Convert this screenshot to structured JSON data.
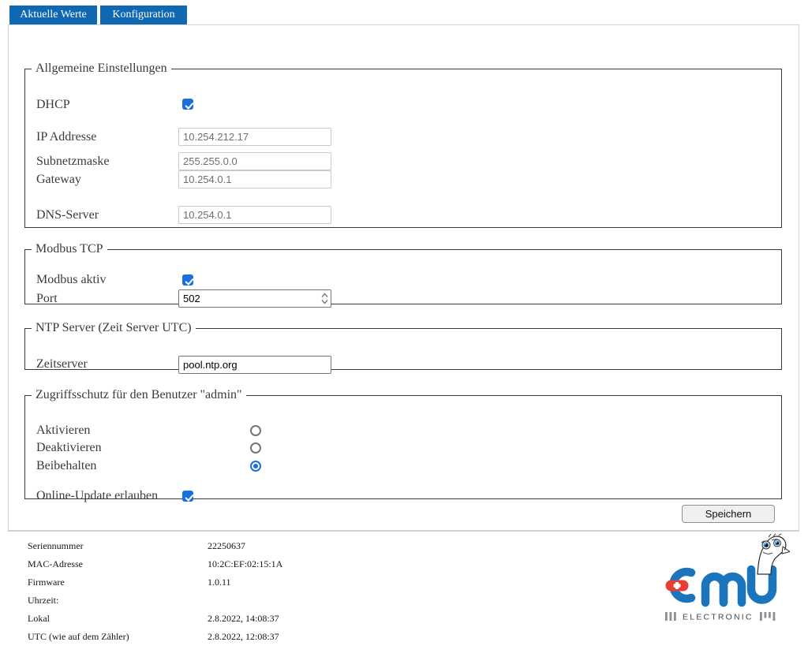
{
  "tabs": [
    {
      "label": "Aktuelle Werte"
    },
    {
      "label": "Konfiguration"
    }
  ],
  "general": {
    "legend": "Allgemeine Einstellungen",
    "dhcp": {
      "label": "DHCP",
      "checked": true
    },
    "fields": {
      "ip": {
        "label": "IP Addresse",
        "value": "10.254.212.17",
        "disabled": true
      },
      "subnet": {
        "label": "Subnetzmaske",
        "value": "255.255.0.0",
        "disabled": true
      },
      "gateway": {
        "label": "Gateway",
        "value": "10.254.0.1",
        "disabled": true
      },
      "dns": {
        "label": "DNS-Server",
        "value": "10.254.0.1",
        "disabled": true
      }
    }
  },
  "modbus": {
    "legend": "Modbus TCP",
    "active": {
      "label": "Modbus aktiv",
      "checked": true
    },
    "port": {
      "label": "Port",
      "value": "502"
    }
  },
  "ntp": {
    "legend": "NTP Server (Zeit Server UTC)",
    "server": {
      "label": "Zeitserver",
      "value": "pool.ntp.org"
    }
  },
  "access": {
    "legend": "Zugriffsschutz für den Benutzer \"admin\"",
    "options": [
      {
        "label": "Aktivieren",
        "selected": false
      },
      {
        "label": "Deaktivieren",
        "selected": false
      },
      {
        "label": "Beibehalten",
        "selected": true
      }
    ],
    "online_update": {
      "label": "Online-Update erlauben",
      "checked": true
    }
  },
  "save_button_label": "Speichern",
  "footer": {
    "rows": [
      {
        "label": "Seriennummer",
        "value": "22250637"
      },
      {
        "label": "MAC-Adresse",
        "value": "10:2C:EF:02:15:1A"
      },
      {
        "label": "Firmware",
        "value": "1.0.11"
      },
      {
        "label": "Uhrzeit:",
        "value": ""
      },
      {
        "label": "Lokal",
        "value": "2.8.2022, 14:08:37"
      },
      {
        "label": "UTC (wie auf dem Zähler)",
        "value": "2.8.2022, 12:08:37"
      }
    ]
  },
  "logo": {
    "brand": "emu",
    "tagline": "ELECTRONIC"
  },
  "colors": {
    "tab_blue": "#1067b2",
    "control_blue": "#1a6fe0",
    "logo_blue": "#1b75bc",
    "logo_red": "#e73d33"
  }
}
